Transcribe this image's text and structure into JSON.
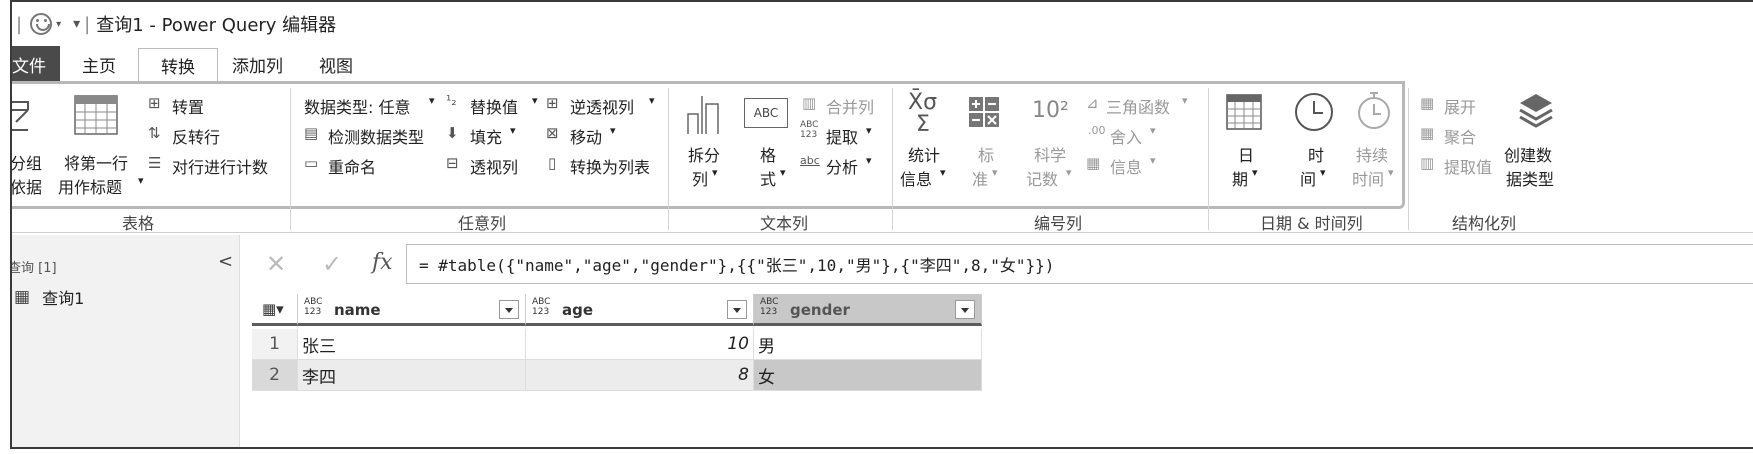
{
  "window": {
    "title": "查询1 - Power Query 编辑器"
  },
  "tabs": [
    {
      "label": "文件"
    },
    {
      "label": "主页"
    },
    {
      "label": "转换"
    },
    {
      "label": "添加列"
    },
    {
      "label": "视图"
    }
  ],
  "ribbon": {
    "table": {
      "group_label": "表格",
      "group_by_1": "分组",
      "group_by_2": "依据",
      "use_first_row_1": "将第一行",
      "use_first_row_2": "用作标题",
      "transpose": "转置",
      "reverse_rows": "反转行",
      "count_rows": "对行进行计数"
    },
    "any_column": {
      "group_label": "任意列",
      "data_type": "数据类型: 任意",
      "detect_type": "检测数据类型",
      "rename": "重命名",
      "replace_values": "替换值",
      "fill": "填充",
      "pivot": "透视列",
      "unpivot": "逆透视列",
      "move": "移动",
      "convert_to_list": "转换为列表"
    },
    "text_column": {
      "group_label": "文本列",
      "split_1": "拆分",
      "split_2": "列",
      "format_1": "格",
      "format_2": "式",
      "merge": "合并列",
      "extract": "提取",
      "parse": "分析",
      "abc_glyph_1": "ABC",
      "abc_glyph_2": "123",
      "abc_glyph_3": "abc"
    },
    "number_column": {
      "group_label": "编号列",
      "statistics_1": "统计",
      "statistics_2": "信息",
      "standard_1": "标",
      "standard_2": "准",
      "scientific_1": "科学",
      "scientific_2": "记数",
      "trigonometry": "三角函数",
      "rounding": "舍入",
      "information": "信息",
      "sigma_glyph": "X̄σ",
      "sum_glyph": "Σ",
      "ten_glyph": "10²",
      "round_glyph": ".00"
    },
    "datetime_column": {
      "group_label": "日期 & 时间列",
      "date_1": "日",
      "date_2": "期",
      "time_1": "时",
      "time_2": "间",
      "duration_1": "持续",
      "duration_2": "时间"
    },
    "structured_column": {
      "group_label": "结构化列",
      "expand": "展开",
      "aggregate": "聚合",
      "extract_values": "提取值",
      "create_type_1": "创建数",
      "create_type_2": "据类型"
    }
  },
  "queries_panel": {
    "header": "查询 [1]",
    "collapse_glyph": "<",
    "items": [
      {
        "label": "查询1"
      }
    ]
  },
  "formula_bar": {
    "cancel_glyph": "✕",
    "confirm_glyph": "✓",
    "fx_glyph": "fx",
    "formula": "= #table({\"name\",\"age\",\"gender\"},{{\"张三\",10,\"男\"},{\"李四\",8,\"女\"}})"
  },
  "grid": {
    "type_glyph_1": "ABC",
    "type_glyph_2": "123",
    "columns": [
      {
        "name": "name"
      },
      {
        "name": "age"
      },
      {
        "name": "gender"
      }
    ],
    "rows": [
      {
        "index": "1",
        "name": "张三",
        "age": "10",
        "gender": "男"
      },
      {
        "index": "2",
        "name": "李四",
        "age": "8",
        "gender": "女"
      }
    ]
  },
  "colors": {
    "file_tab": "#4a4a4a",
    "selected_column": "#c8c8c8",
    "ribbon_border": "#b8b8b8"
  }
}
